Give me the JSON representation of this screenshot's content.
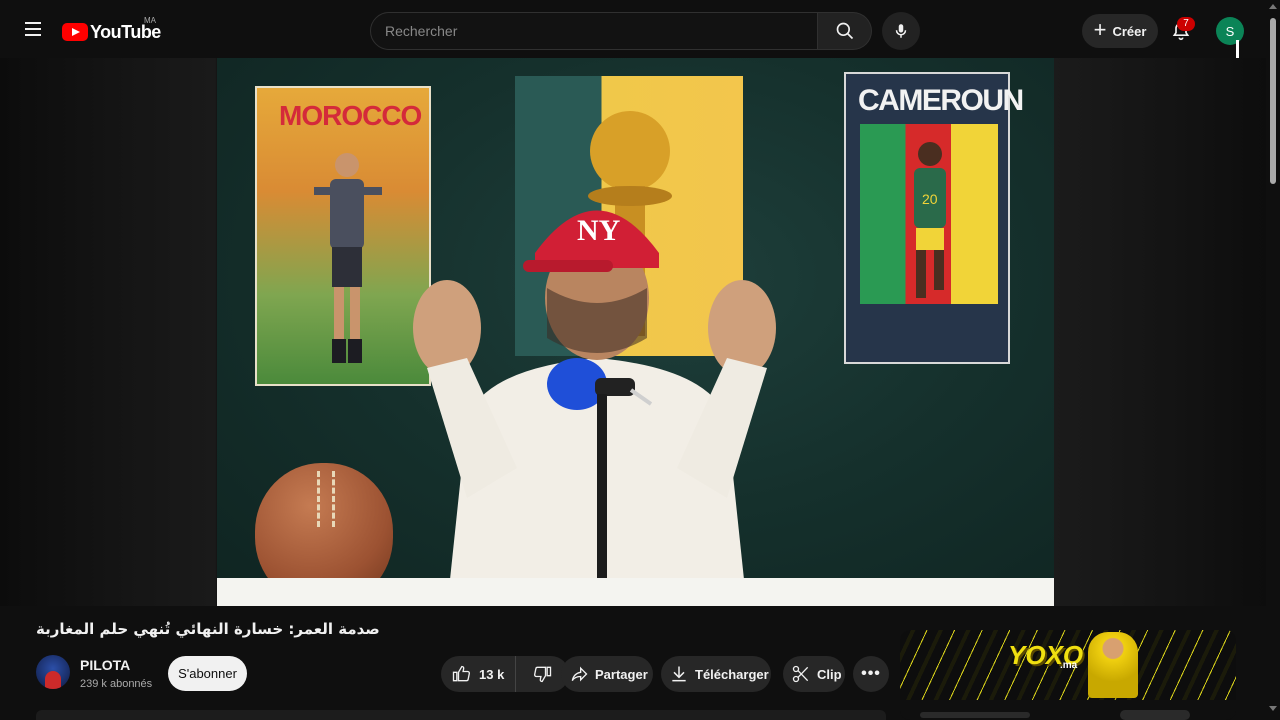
{
  "header": {
    "logo_text": "YouTube",
    "country_code": "MA",
    "search_placeholder": "Rechercher",
    "create_label": "Créer",
    "notification_count": "7",
    "avatar_letter": "S"
  },
  "video": {
    "poster_left_text": "MOROCCO",
    "poster_right_text": "CAMEROUN",
    "cap_text": "NY"
  },
  "watch": {
    "title": "صدمة العمر: خسارة النهائي تُنهي حلم المغاربة",
    "channel_name": "PILOTA",
    "subscribers": "239 k abonnés",
    "subscribe_label": "S'abonner",
    "like_count": "13 k",
    "share_label": "Partager",
    "download_label": "Télécharger",
    "clip_label": "Clip",
    "more_label": "•••"
  },
  "ad": {
    "brand": "YOXO",
    "brand_suffix": ".ma"
  },
  "colors": {
    "brand_red": "#ff0000",
    "background": "#0f0f0f",
    "pill_bg": "#272727",
    "subscribe_bg": "#f1f1f1",
    "badge_red": "#cc0000",
    "avatar_green": "#0b8457"
  }
}
